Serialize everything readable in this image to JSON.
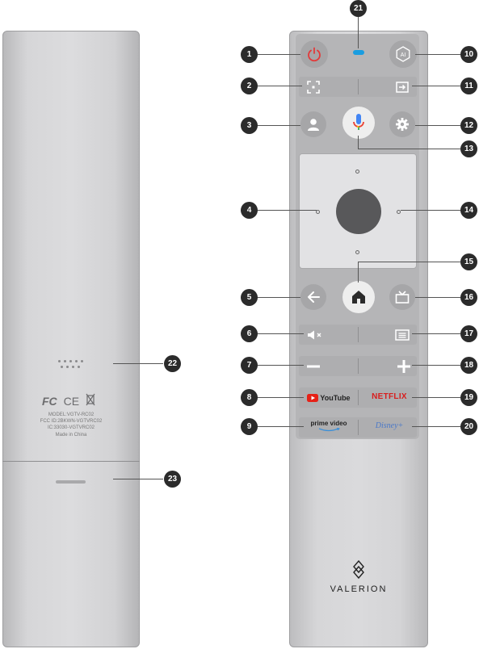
{
  "back": {
    "fcc_logo": "FC",
    "ce_logo": "CE",
    "model_line": "MODEL:VGTV-RC02",
    "fcc_line": "FCC ID:2BKWN-VGTVRC02",
    "ic_line": "IC:33030-VGTVRC02",
    "made_line": "Made in China"
  },
  "front": {
    "youtube_label": "YouTube",
    "netflix_label": "NETFLIX",
    "prime_label": "prime video",
    "disney_label": "Disney+",
    "brand": "VALERION"
  },
  "callouts": {
    "n1": "1",
    "n2": "2",
    "n3": "3",
    "n4": "4",
    "n5": "5",
    "n6": "6",
    "n7": "7",
    "n8": "8",
    "n9": "9",
    "n10": "10",
    "n11": "11",
    "n12": "12",
    "n13": "13",
    "n14": "14",
    "n15": "15",
    "n16": "16",
    "n17": "17",
    "n18": "18",
    "n19": "19",
    "n20": "20",
    "n21": "21",
    "n22": "22",
    "n23": "23"
  },
  "colors": {
    "power": "#e23b3b",
    "indicator": "#1a9de0",
    "callout": "#2b2b2b",
    "netflix": "#d81e1e",
    "youtube": "#e62117",
    "disney": "#4a78c8"
  }
}
